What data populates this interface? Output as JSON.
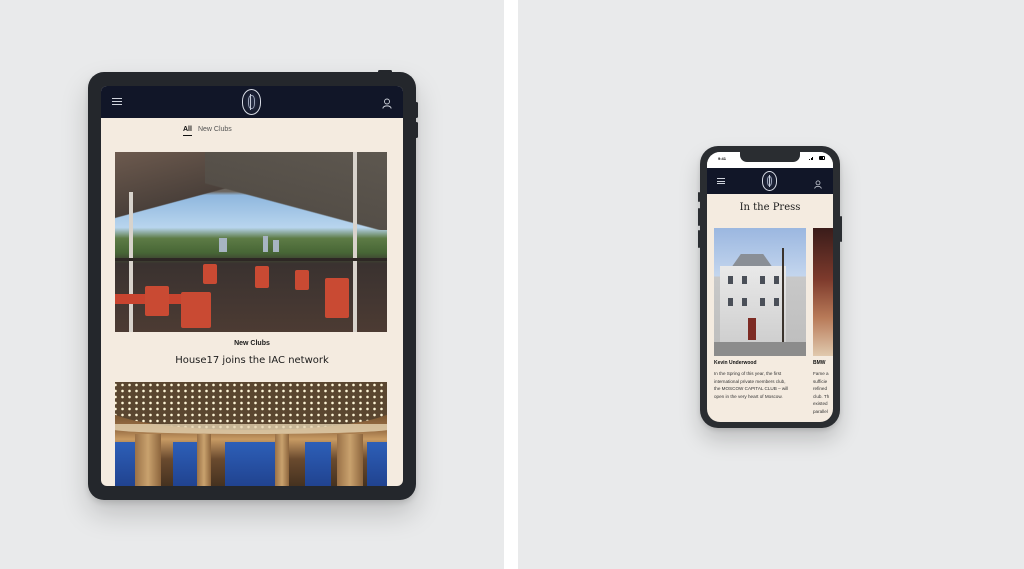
{
  "tablet": {
    "tabs": [
      {
        "label": "All",
        "active": true
      },
      {
        "label": "New Clubs",
        "active": false
      }
    ],
    "feature": {
      "category": "New Clubs",
      "title": "House17 joins the IAC network"
    },
    "icons": {
      "menu": "hamburger-menu-icon",
      "logo": "club-crest-logo",
      "account": "user-icon"
    }
  },
  "phone": {
    "status_time": "9:41",
    "section_title": "In the Press",
    "cards": [
      {
        "author": "Kevin Underwood",
        "lines": [
          "In the Spring of this year, the first",
          "international private members club,",
          "the MOSCOW CAPITAL CLUB – will",
          "open in the very heart of Moscow."
        ]
      },
      {
        "author": "BMW",
        "lines": [
          "Fame a",
          "sufficie",
          "refined",
          "club. Th",
          "existed",
          "parallel"
        ]
      }
    ]
  },
  "colors": {
    "nav_background": "#111628",
    "page_background": "#f4ebe0",
    "backdrop": "#e9eaeb",
    "device_frame": "#24272c"
  }
}
